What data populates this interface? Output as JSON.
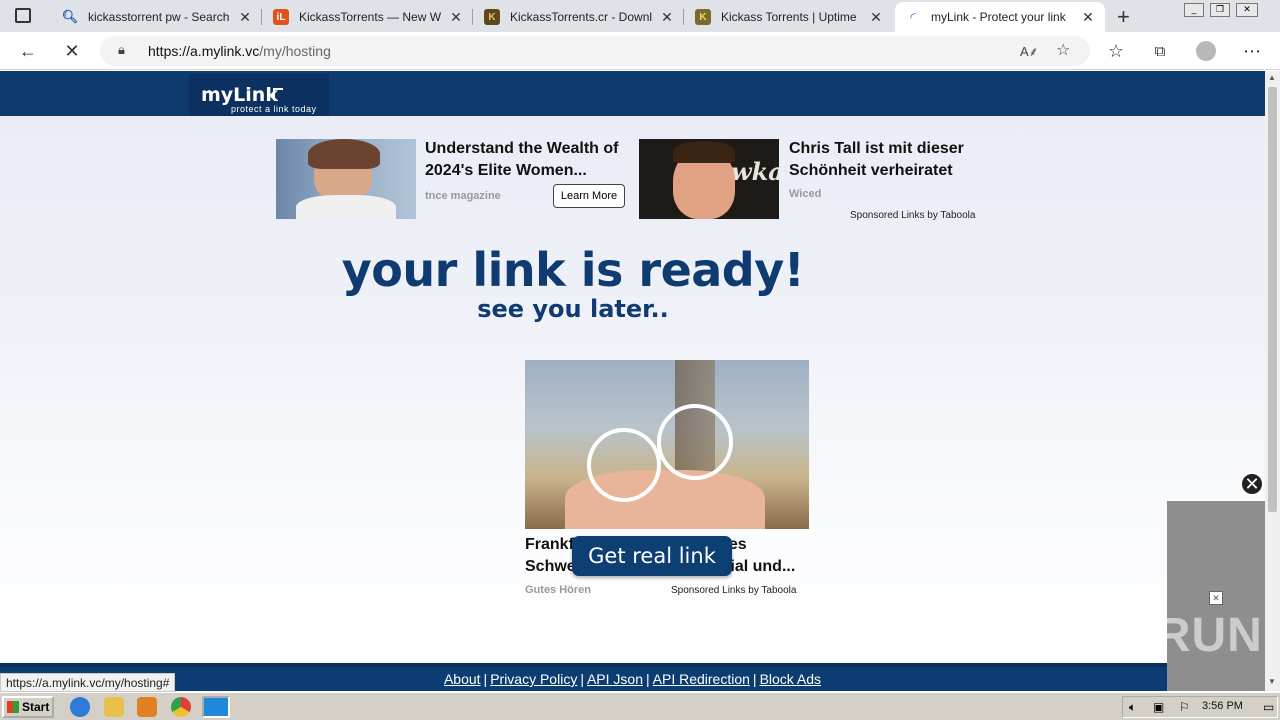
{
  "browser": {
    "tabs": [
      {
        "label": "kickasstorrent pw - Search",
        "favicon": "search-icon",
        "active": false
      },
      {
        "label": "KickassTorrents — New W",
        "favicon": "il-logo-icon",
        "active": false
      },
      {
        "label": "KickassTorrents.cr - Downl",
        "favicon": "kat-logo-icon",
        "active": false
      },
      {
        "label": "Kickass Torrents | Uptime",
        "favicon": "kat-logo-icon",
        "active": false
      },
      {
        "label": "myLink - Protect your link",
        "favicon": "loading-icon",
        "active": true
      }
    ],
    "url_host": "https://a.mylink.vc",
    "url_path": "/my/hosting"
  },
  "site": {
    "logo_name": "myLink",
    "logo_tagline": "protect a link today",
    "headline": "your link is ready!",
    "subheadline": "see you later..",
    "get_link_label": "Get real link"
  },
  "ads": {
    "top_left": {
      "title": "Understand the Wealth of 2024's Elite Women...",
      "source": "tnce magazine",
      "cta": "Learn More"
    },
    "top_right": {
      "title": "Chris Tall ist mit dieser Schönheit verheiratet",
      "source": "Wiced",
      "image_text": "wka"
    },
    "top_sponsor": "Sponsored Links by Taboola",
    "middle": {
      "title": "Frankfurt Am Main: Neuestes Schweizer Hörgerät ist genial und...",
      "source": "Gutes Hören",
      "sponsor": "Sponsored Links by Taboola"
    }
  },
  "footer": {
    "links": [
      "About",
      "Privacy Policy",
      "API Json",
      "API Redirection",
      "Block Ads"
    ]
  },
  "status_url": "https://a.mylink.vc/my/hosting#",
  "watermark": "ANY RUN",
  "taskbar": {
    "start_label": "Start",
    "clock": "3:56 PM"
  },
  "colors": {
    "brand_navy": "#0e3a6e",
    "headline": "#0f3b70",
    "button": "#0d3f73"
  }
}
